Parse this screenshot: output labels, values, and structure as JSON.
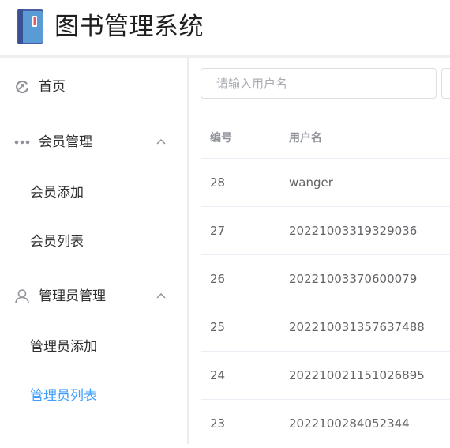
{
  "app": {
    "title": "图书管理系统"
  },
  "sidebar": {
    "home": {
      "label": "首页"
    },
    "member_group": {
      "label": "会员管理",
      "items": [
        {
          "label": "会员添加"
        },
        {
          "label": "会员列表"
        }
      ]
    },
    "admin_group": {
      "label": "管理员管理",
      "items": [
        {
          "label": "管理员添加"
        },
        {
          "label": "管理员列表",
          "active": true
        }
      ]
    }
  },
  "search": {
    "placeholder": "请输入用户名",
    "value": ""
  },
  "table": {
    "headers": [
      "编号",
      "用户名"
    ],
    "rows": [
      {
        "id": "28",
        "username": "wanger"
      },
      {
        "id": "27",
        "username": "20221003319329036"
      },
      {
        "id": "26",
        "username": "20221003370600079"
      },
      {
        "id": "25",
        "username": "202210031357637488"
      },
      {
        "id": "24",
        "username": "202210021151026895"
      },
      {
        "id": "23",
        "username": "2022100284052344"
      }
    ]
  },
  "colors": {
    "accent": "#409eff",
    "text": "#303133",
    "muted": "#909399",
    "border": "#ebeef5"
  },
  "icons": {
    "logo": "book-icon",
    "home": "home-icon",
    "member": "more-dots-icon",
    "admin": "user-icon",
    "collapse": "chevron-up-icon"
  }
}
